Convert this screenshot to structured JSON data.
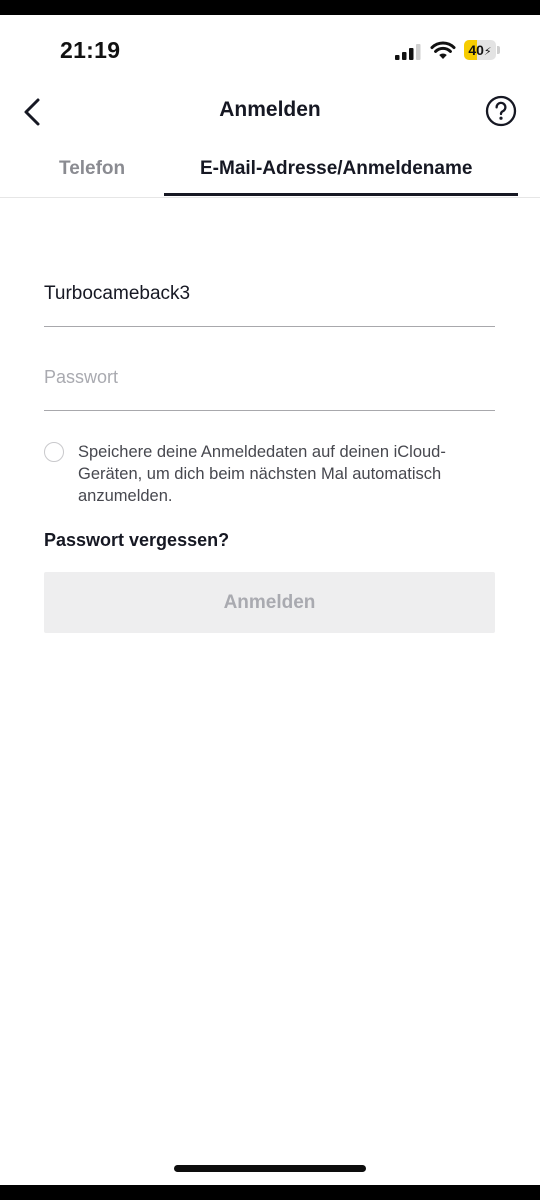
{
  "status_bar": {
    "time": "21:19",
    "battery_text": "40",
    "battery_level": 0.4,
    "battery_color": "#f6cc00",
    "icons": [
      "cellular-signal-icon",
      "wifi-icon",
      "battery-charging-icon"
    ]
  },
  "header": {
    "title": "Anmelden",
    "back_icon": "chevron-left-icon",
    "help_icon": "question-circle-icon"
  },
  "tabs": [
    {
      "label": "Telefon",
      "active": false
    },
    {
      "label": "E-Mail-Adresse/Anmeldename",
      "active": true
    }
  ],
  "form": {
    "username_value": "Turbocameback3",
    "password_placeholder": "Passwort",
    "save_credentials_text": "Speichere deine Anmeldedaten auf deinen iCloud-Geräten, um dich beim nächsten Mal automatisch anzumelden.",
    "save_credentials_checked": false,
    "forgot_password_label": "Passwort vergessen?",
    "submit_label": "Anmelden",
    "submit_enabled": false
  },
  "colors": {
    "text_primary": "#161823",
    "text_secondary": "#8a8b91",
    "button_disabled_bg": "#eeeeef",
    "button_disabled_text": "#a9aab0"
  }
}
